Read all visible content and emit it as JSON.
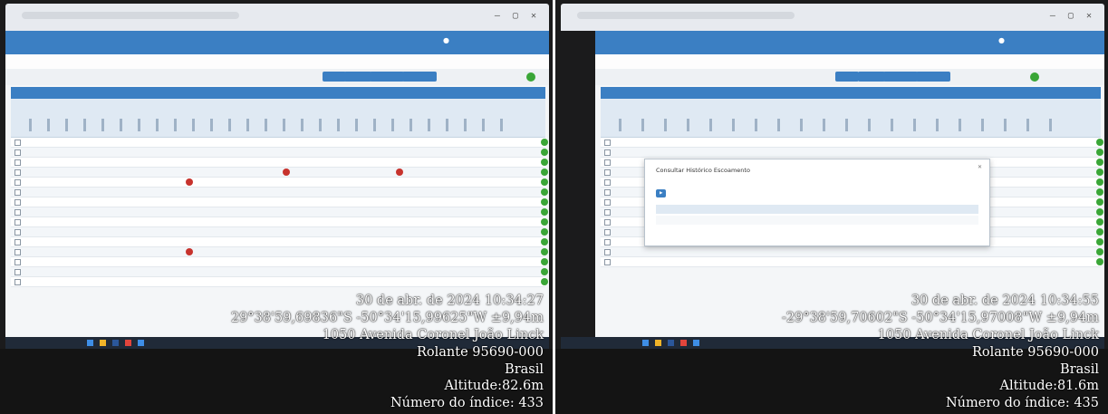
{
  "photos": [
    {
      "stamp": {
        "datetime": "30 de abr. de 2024 10:34:27",
        "coordinates": "29°38'59,69836\"S -50°34'15,99625\"W ±9,94m",
        "street": "1050 Avenida Coronel João Linck",
        "city": "Rolante 95690-000",
        "country": "Brasil",
        "altitude": "Altitude:82.6m",
        "index": "Número do índice: 433"
      }
    },
    {
      "stamp": {
        "datetime": "30 de abr. de 2024 10:34:55",
        "coordinates": "-29°38'59,70602\"S -50°34'15,97008\"W ±9,94m",
        "street": "1050 Avenida Coronel João Linck",
        "city": "Rolante 95690-000",
        "country": "Brasil",
        "altitude": "Altitude:81.6m",
        "index": "Número do índice: 435"
      },
      "modal": {
        "title": "Consultar Histórico Escoamento"
      }
    }
  ],
  "colors": {
    "header_blue": "#3b7fc3",
    "status_green": "#3aa637",
    "alert_red": "#c7332d"
  }
}
